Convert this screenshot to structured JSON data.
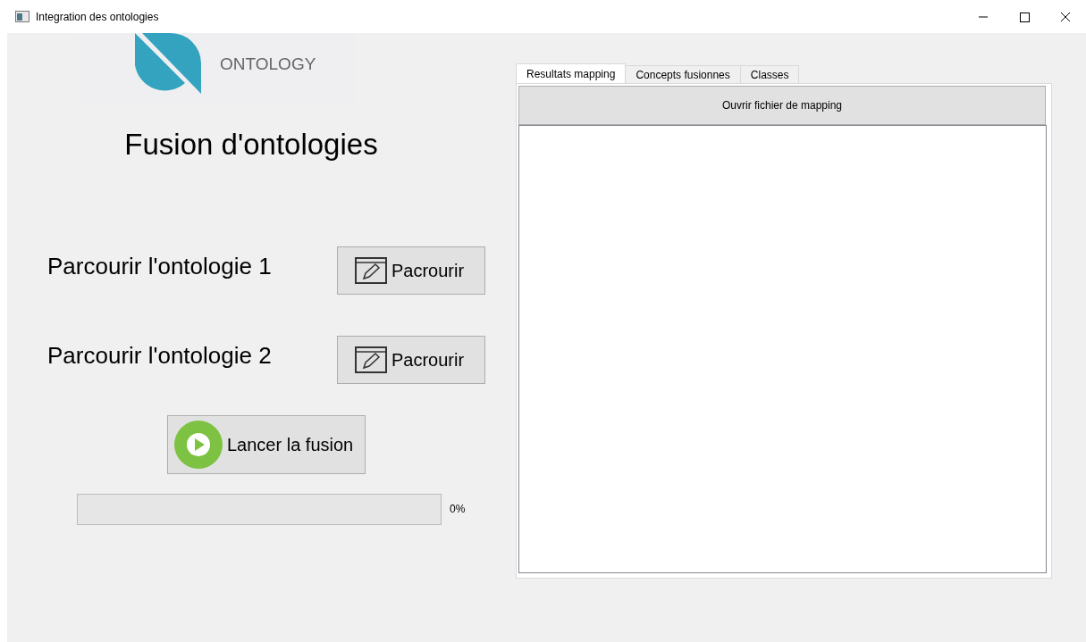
{
  "window": {
    "title": "Integration des ontologies"
  },
  "logo": {
    "text": "ONTOLOGY"
  },
  "heading": "Fusion d'ontologies",
  "browse_rows": [
    {
      "label": "Parcourir l'ontologie 1",
      "button": "Pacrourir"
    },
    {
      "label": "Parcourir l'ontologie 2",
      "button": "Pacrourir"
    }
  ],
  "run_button": "Lancer la fusion",
  "progress": {
    "level": 0,
    "reading": "0%"
  },
  "tabs": [
    {
      "label": "Resultats mapping",
      "selected": true
    },
    {
      "label": "Concepts fusionnes",
      "selected": false
    },
    {
      "label": "Classes",
      "selected": false
    }
  ],
  "open_button": "Ouvrir fichier de mapping"
}
